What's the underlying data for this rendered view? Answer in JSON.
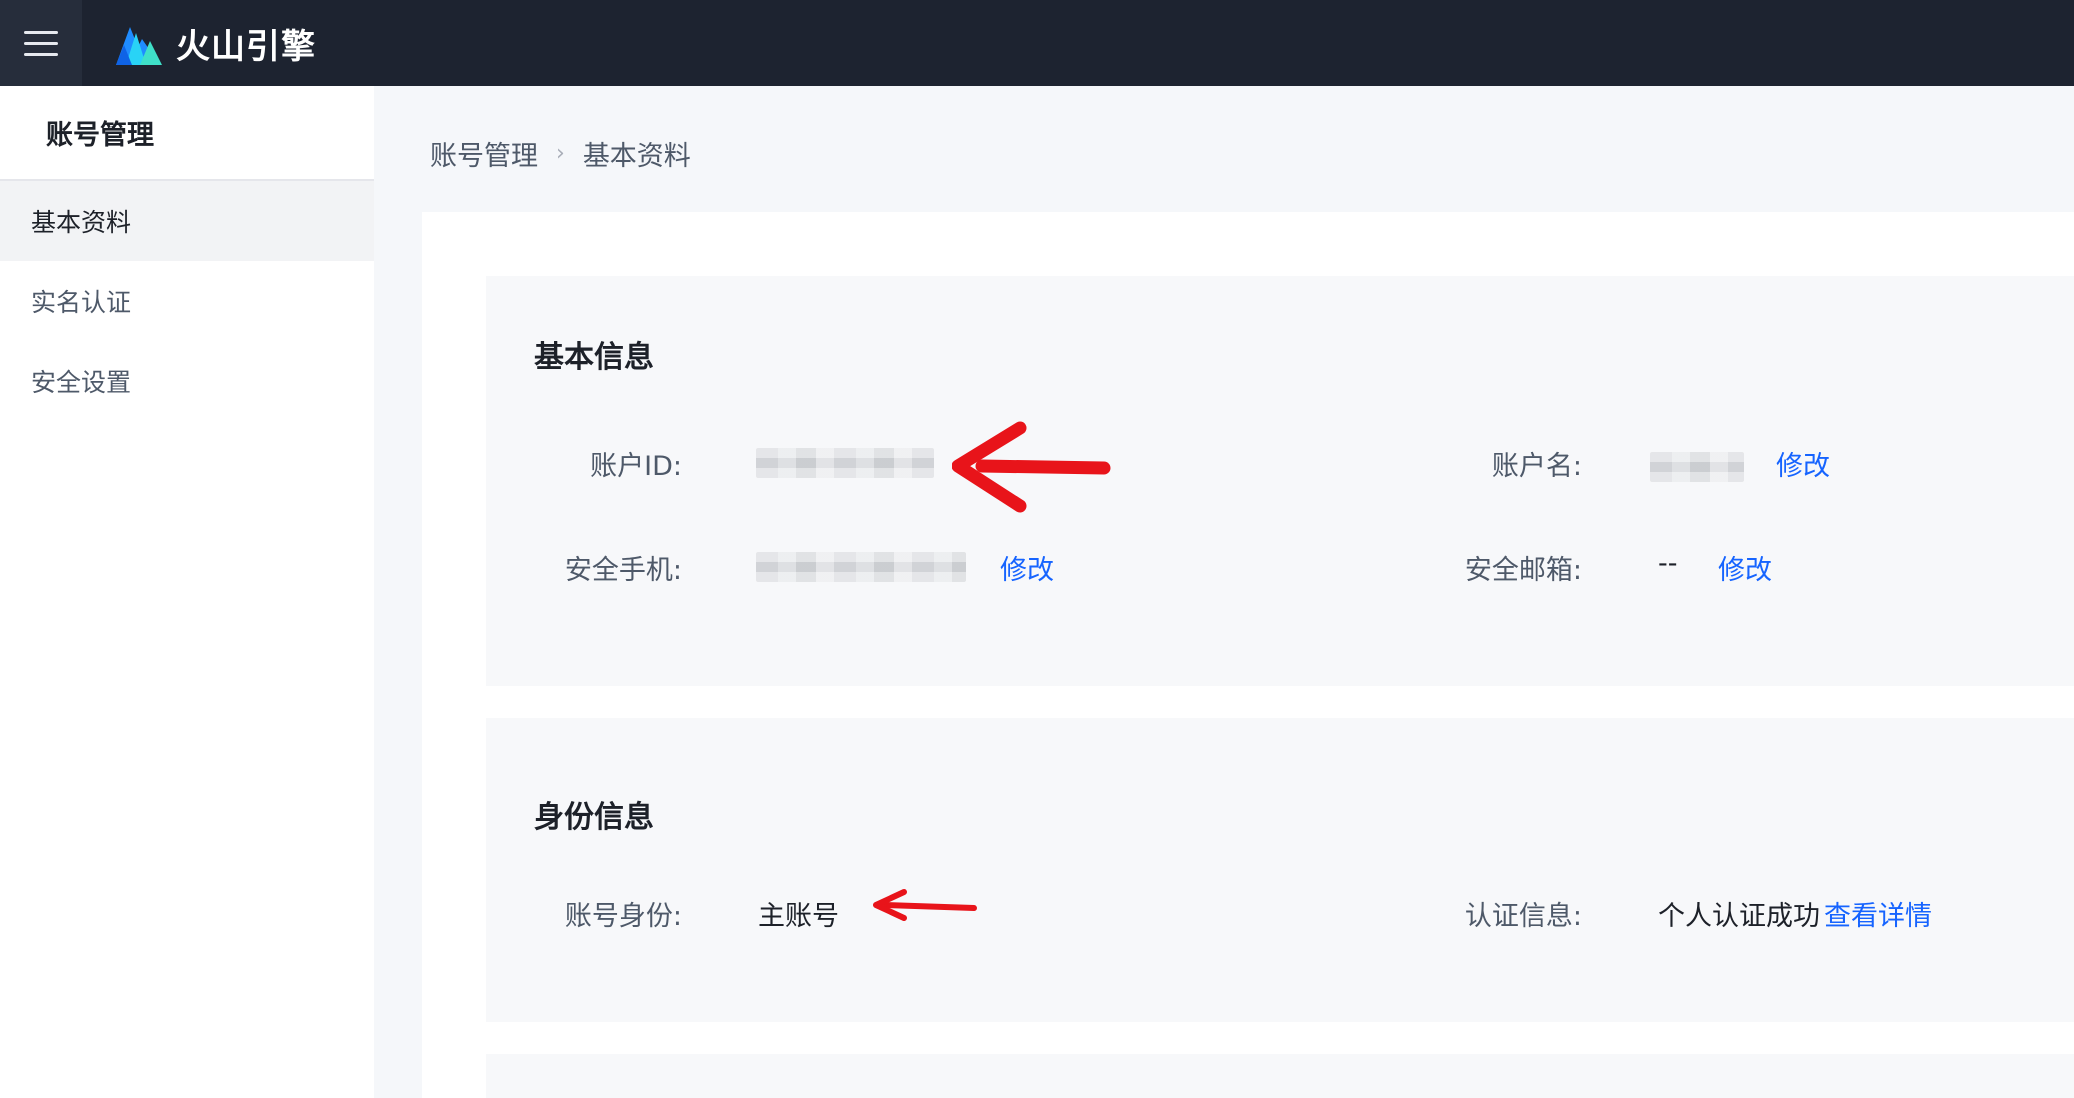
{
  "header": {
    "brand_name": "火山引擎",
    "menu_icon": "hamburger-menu-icon",
    "logo_icon": "volcano-logo-icon",
    "background": "#1d2330"
  },
  "sidebar": {
    "title": "账号管理",
    "items": [
      {
        "label": "基本资料",
        "active": true
      },
      {
        "label": "实名认证",
        "active": false
      },
      {
        "label": "安全设置",
        "active": false
      }
    ]
  },
  "breadcrumb": {
    "parent": "账号管理",
    "current": "基本资料"
  },
  "basic_info": {
    "title": "基本信息",
    "account_id_label": "账户ID:",
    "account_name_label": "账户名:",
    "account_name_edit": "修改",
    "phone_label": "安全手机:",
    "phone_edit": "修改",
    "email_label": "安全邮箱:",
    "email_value": "--",
    "email_edit": "修改"
  },
  "identity_info": {
    "title": "身份信息",
    "role_label": "账号身份:",
    "role_value": "主账号",
    "cert_label": "认证信息:",
    "cert_value": "个人认证成功",
    "cert_link": "查看详情"
  },
  "colors": {
    "link": "#1664ff",
    "annotation_arrow": "#e8141a"
  }
}
